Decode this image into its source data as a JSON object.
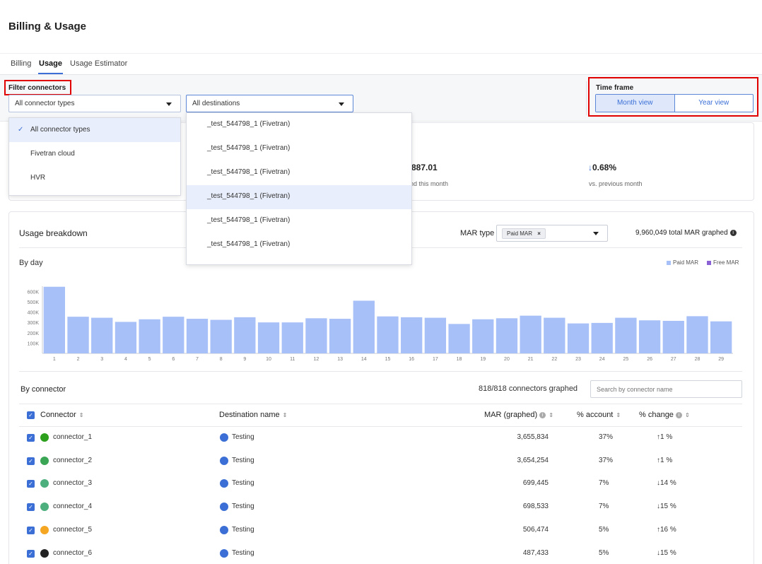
{
  "title": "Billing & Usage",
  "tabs": [
    {
      "label": "Billing"
    },
    {
      "label": "Usage"
    },
    {
      "label": "Usage Estimator"
    }
  ],
  "filters": {
    "connectors_label": "Filter connectors",
    "connector_select_value": "All connector types",
    "destination_select_value": "All destinations",
    "timeframe_label": "Time frame",
    "month_view": "Month view",
    "year_view": "Year view"
  },
  "connector_dropdown": {
    "items": [
      "All connector types",
      "Fivetran cloud",
      "HVR"
    ],
    "selected": "All connector types"
  },
  "destination_dropdown": {
    "items": [
      "_test_544798_1 (Fivetran)",
      "_test_544798_1 (Fivetran)",
      "_test_544798_1 (Fivetran)",
      "_test_544798_1 (Fivetran)",
      "_test_544798_1 (Fivetran)",
      "_test_544798_1 (Fivetran)"
    ]
  },
  "stats": {
    "spend_value": "887.01",
    "spend_sub": "nd this month",
    "change_value": "0.68%",
    "change_sub": "vs. previous month"
  },
  "usage": {
    "title": "Usage breakdown",
    "mar_type_label": "MAR type",
    "mar_chip": "Paid MAR",
    "total_label": "9,960,049 total MAR graphed",
    "by_day": "By day",
    "legend_paid": "Paid MAR",
    "legend_free": "Free MAR",
    "paid_color": "#a8c0f8",
    "free_color": "#8a62d6"
  },
  "chart_data": {
    "type": "bar",
    "title": "",
    "xlabel": "",
    "ylabel": "",
    "y_ticks": [
      "100K",
      "200K",
      "300K",
      "400K",
      "500K",
      "600K"
    ],
    "ylim": [
      0,
      650000
    ],
    "categories": [
      "1",
      "2",
      "3",
      "4",
      "5",
      "6",
      "7",
      "8",
      "9",
      "10",
      "11",
      "12",
      "13",
      "14",
      "15",
      "16",
      "17",
      "18",
      "19",
      "20",
      "21",
      "22",
      "23",
      "24",
      "25",
      "26",
      "27",
      "28",
      "29"
    ],
    "series": [
      {
        "name": "Paid MAR",
        "values": [
          645000,
          355000,
          345000,
          305000,
          330000,
          355000,
          335000,
          325000,
          350000,
          300000,
          300000,
          340000,
          335000,
          510000,
          358000,
          350000,
          345000,
          285000,
          330000,
          340000,
          365000,
          345000,
          290000,
          295000,
          345000,
          320000,
          315000,
          360000,
          310000
        ]
      }
    ]
  },
  "by_connector": {
    "title": "By connector",
    "graphed_label": "818/818 connectors graphed",
    "search_placeholder": "Search by connector name",
    "columns": {
      "connector": "Connector",
      "destination": "Destination name",
      "mar": "MAR (graphed)",
      "account": "% account",
      "change": "% change"
    },
    "rows": [
      {
        "name": "connector_1",
        "destination": "Testing",
        "mar": "3,655,834",
        "account": "37%",
        "change": "1 %",
        "dir": "up",
        "icon": "quickbooks-icon",
        "icon_color": "#2ca01c"
      },
      {
        "name": "connector_2",
        "destination": "Testing",
        "mar": "3,654,254",
        "account": "37%",
        "change": "1 %",
        "dir": "up",
        "icon": "brand-wordmark-icon",
        "icon_color": "#3aa655"
      },
      {
        "name": "connector_3",
        "destination": "Testing",
        "mar": "699,445",
        "account": "7%",
        "change": "14 %",
        "dir": "down",
        "icon": "android-icon",
        "icon_color": "#4caf7d"
      },
      {
        "name": "connector_4",
        "destination": "Testing",
        "mar": "698,533",
        "account": "7%",
        "change": "15 %",
        "dir": "down",
        "icon": "android-icon",
        "icon_color": "#4caf7d"
      },
      {
        "name": "connector_5",
        "destination": "Testing",
        "mar": "506,474",
        "account": "5%",
        "change": "16 %",
        "dir": "up",
        "icon": "firebase-icon",
        "icon_color": "#f5a623"
      },
      {
        "name": "connector_6",
        "destination": "Testing",
        "mar": "487,433",
        "account": "5%",
        "change": "15 %",
        "dir": "down",
        "icon": "github-icon",
        "icon_color": "#222222"
      }
    ]
  }
}
